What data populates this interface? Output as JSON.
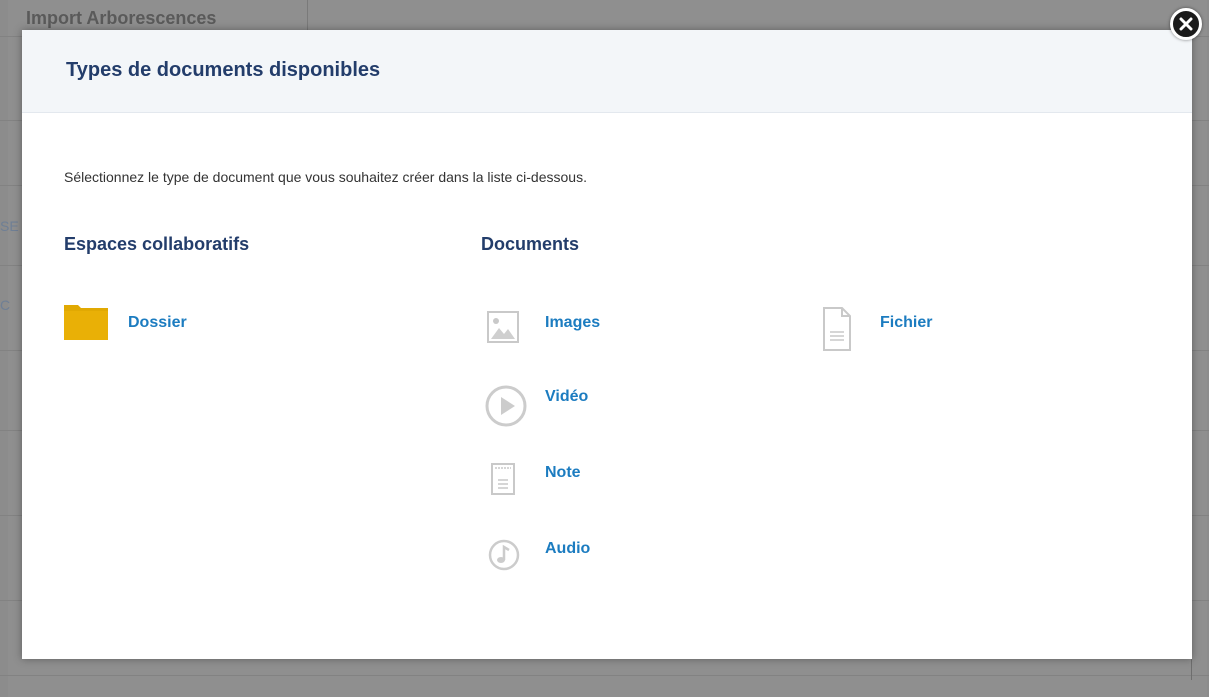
{
  "background": {
    "tab_label": "Import Arborescences",
    "edge_fragment_1": "SE",
    "edge_fragment_2": "C"
  },
  "dialog": {
    "title": "Types de documents disponibles",
    "close_icon": "close-icon",
    "instruction": "Sélectionnez le type de document que vous souhaitez créer dans la liste ci-dessous.",
    "sections": {
      "collaborative": {
        "heading": "Espaces collaboratifs",
        "items": [
          {
            "label": "Dossier",
            "icon": "folder-icon"
          }
        ]
      },
      "documents": {
        "heading": "Documents",
        "items": [
          {
            "label": "Images",
            "icon": "image-icon"
          },
          {
            "label": "Vidéo",
            "icon": "video-icon"
          },
          {
            "label": "Note",
            "icon": "note-icon"
          },
          {
            "label": "Audio",
            "icon": "audio-icon"
          },
          {
            "label": "Fichier",
            "icon": "file-icon"
          }
        ]
      }
    }
  },
  "colors": {
    "heading": "#233d6b",
    "link": "#1c7cc0",
    "folder": "#e1a902",
    "icon_gray": "#c9c9c9"
  }
}
